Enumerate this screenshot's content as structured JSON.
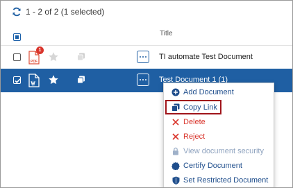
{
  "header": {
    "count_text": "1 - 2 of 2 (1 selected)"
  },
  "columns": {
    "title": "Title"
  },
  "rows": [
    {
      "title": "TI automate Test Document",
      "selected": false,
      "badge": "1",
      "file_label": "PDF",
      "file_type": "pdf"
    },
    {
      "title": "Test Document 1 (1)",
      "selected": true,
      "file_type": "doc"
    }
  ],
  "menu": {
    "items": [
      {
        "label": "Add Document",
        "icon": "plus-circle-icon"
      },
      {
        "label": "Copy Link",
        "icon": "copy-icon",
        "highlighted": true
      },
      {
        "label": "Delete",
        "icon": "x-icon"
      },
      {
        "label": "Reject",
        "icon": "x-icon"
      },
      {
        "label": "View document security",
        "icon": "lock-icon",
        "disabled": true
      },
      {
        "label": "Certify Document",
        "icon": "certify-badge-icon"
      },
      {
        "label": "Set Restricted Document",
        "icon": "shield-icon"
      }
    ]
  },
  "colors": {
    "selected_row": "#1f5fa3",
    "danger": "#d9342b",
    "highlight_border": "#a0141a",
    "link": "#1f4e8c"
  }
}
